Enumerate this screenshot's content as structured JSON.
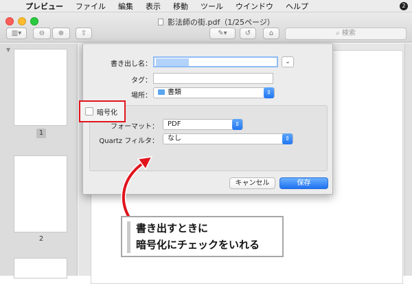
{
  "menubar": {
    "app_name": "プレビュー",
    "items": [
      "ファイル",
      "編集",
      "表示",
      "移動",
      "ツール",
      "ウインドウ",
      "ヘルプ"
    ],
    "badge": "2"
  },
  "window": {
    "title": "影法師の街.pdf（1/25ページ）",
    "search_placeholder": "検索"
  },
  "sidebar": {
    "pages": [
      "1",
      "2"
    ]
  },
  "dialog": {
    "export_as_label": "書き出し名：",
    "export_as_value": "",
    "tags_label": "タグ：",
    "tags_value": "",
    "where_label": "場所：",
    "where_value": "書類",
    "format_label": "フォーマット：",
    "format_value": "PDF",
    "quartz_label": "Quartz フィルタ：",
    "quartz_value": "なし",
    "encrypt_label": "暗号化",
    "encrypt_checked": false,
    "cancel_label": "キャンセル",
    "save_label": "保存"
  },
  "callout": {
    "line1": "書き出すときに",
    "line2": "暗号化にチェックをいれる"
  },
  "colors": {
    "highlight_red": "#e1141d",
    "accent_blue": "#1f72f2"
  }
}
